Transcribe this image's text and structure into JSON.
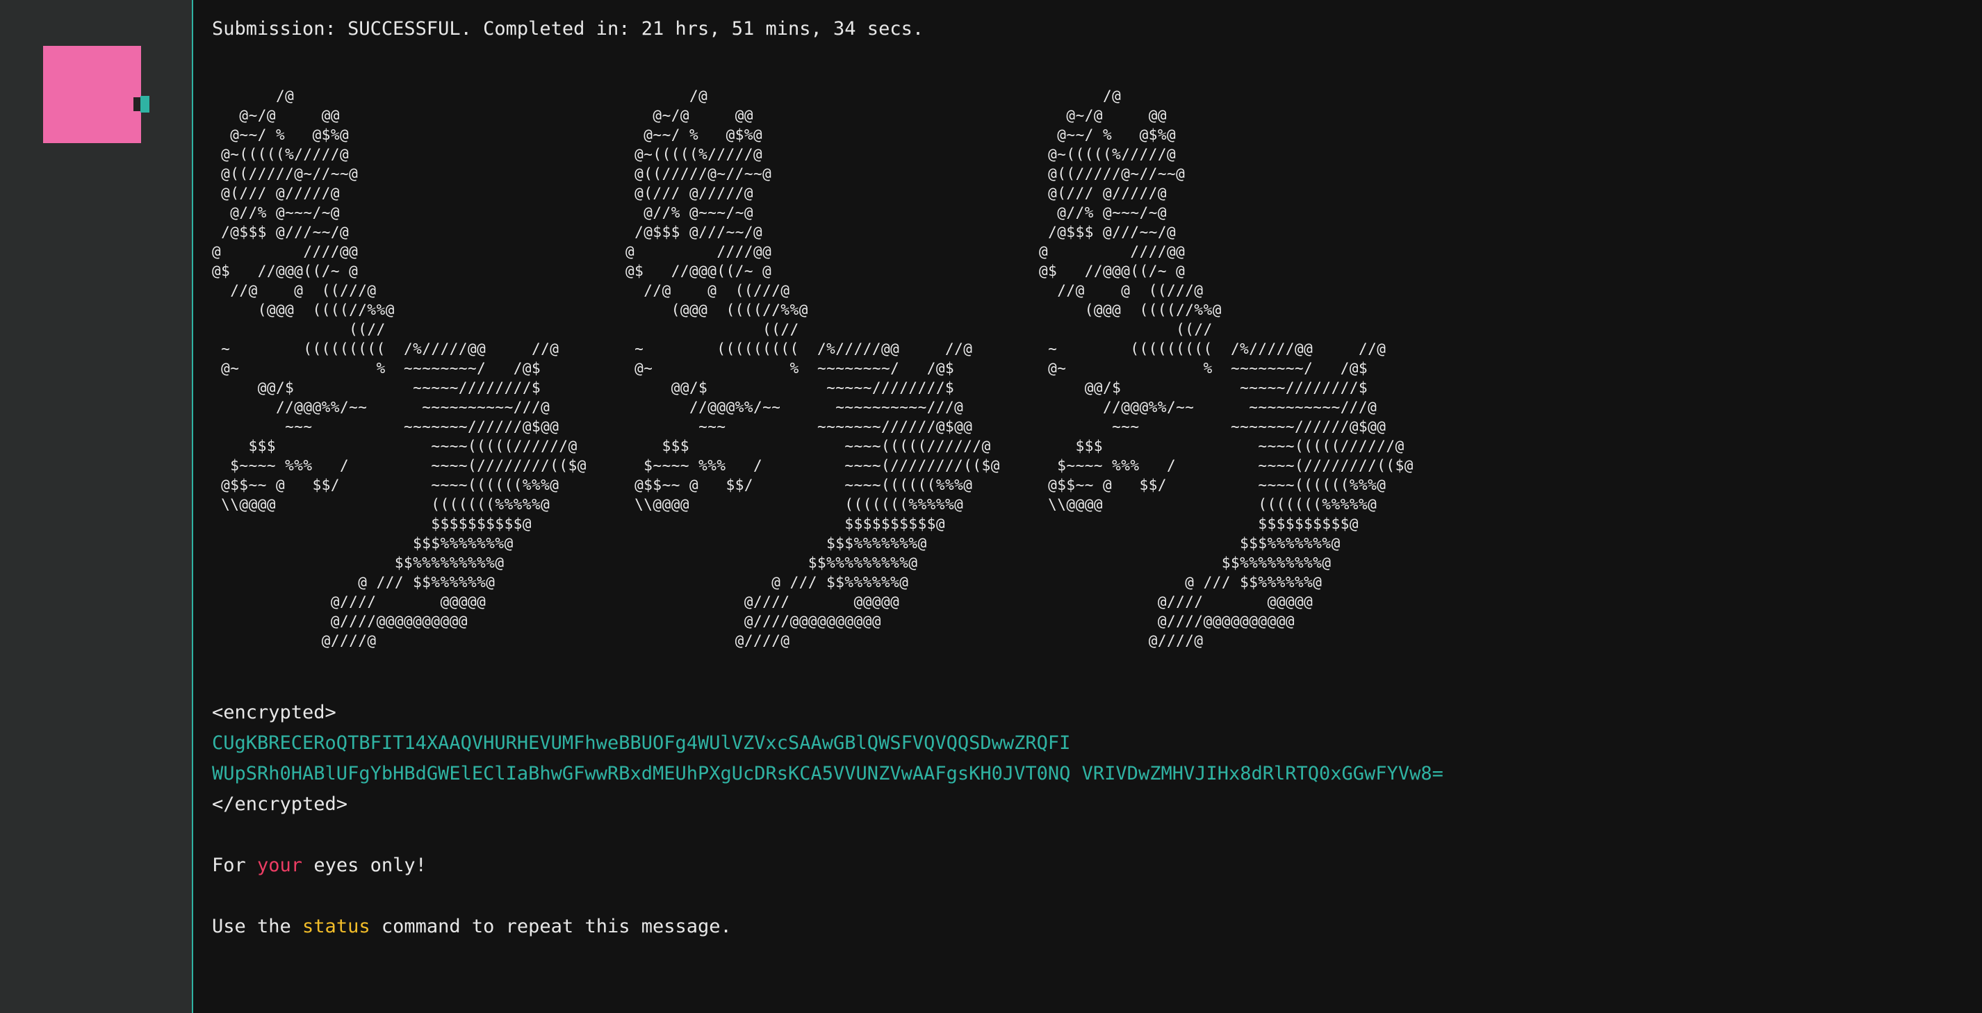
{
  "terminal": {
    "status_line": "Submission: SUCCESSFUL. Completed in: 21 hrs, 51 mins, 34 secs.",
    "ascii_art": "       /@\n   @~/@     @@\n  @~~/ %   @$%@\n @~(((((%/////@\n @((/////@~//~~@\n @(/// @/////@\n  @//% @~~~/~@\n /@$$$ @///~~/@\n@         ////@@\n@$   //@@@((/~ @\n  //@    @  ((///@\n     (@@@  ((((//%%@\n               ((//\n ~        (((((((((  /%/////@@     //@\n @~               %  ~~~~~~~~/   /@$\n     @@/$             ~~~~~////////$\n       //@@@%%/~~      ~~~~~~~~~~///@\n        ~~~          ~~~~~~~//////@$@@\n    $$$                 ~~~~(((((//////@\n  $~~~~ %%%   /         ~~~~(////////(($@\n @$$~~ @   $$/          ~~~~((((((%%%@\n \\\\@@@@                 (((((((%%%%%@\n                        $$$$$$$$$$@\n                      $$$%%%%%%%@\n                    $$%%%%%%%%%@\n                @ /// $$%%%%%%@\n             @////       @@@@@\n             @////@@@@@@@@@@\n            @////@",
    "encrypted_open": "<encrypted>",
    "encrypted_line1": "CUgKBRECERoQTBFIT14XAAQVHURHEVUMFhweBBUOFg4WUlVZVxcSAAwGBlQWSFVQVQQSDwwZRQFI",
    "encrypted_line2": "WUpSRh0HABlUFgYbHBdGWElEClIaBhwGFwwRBxdMEUhPXgUcDRsKCA5VVUNZVwAAFgsKH0JVT0NQ VRIVDwZMHVJIHx8dRlRTQ0xGGwFYVw8=",
    "encrypted_close": "</encrypted>",
    "eyes_prefix": "For ",
    "eyes_highlight": "your",
    "eyes_suffix": " eyes only!",
    "hint_prefix": "Use the ",
    "hint_command": "status",
    "hint_suffix": " command to repeat this message."
  },
  "colors": {
    "accent_teal": "#2fb3a3",
    "avatar_pink": "#ef6aa9",
    "highlight_red": "#ec3d64",
    "highlight_yellow": "#f2bd29"
  }
}
